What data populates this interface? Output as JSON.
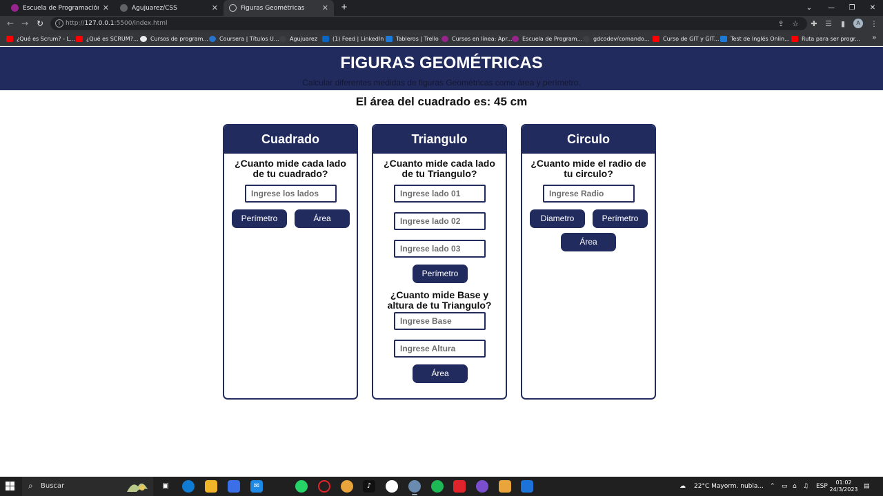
{
  "browser": {
    "tabs": [
      {
        "title": "Escuela de Programación y Desa",
        "color": "#98258e"
      },
      {
        "title": "Agujuarez/CSS",
        "color": "#5f6368"
      },
      {
        "title": "Figuras Geométricas",
        "color": "#8ab4f8"
      }
    ],
    "new_tab": "+",
    "url_prefix": "http://",
    "url_host": "127.0.0.1",
    "url_rest": ":5500/index.html",
    "profile_initial": "A"
  },
  "bookmarks": [
    {
      "label": "¿Qué es Scrum? - L...",
      "color": "#ff0000"
    },
    {
      "label": "¿Qué es SCRUM?...",
      "color": "#ff0000"
    },
    {
      "label": "Cursos de program...",
      "color": "#e8eaed"
    },
    {
      "label": "Coursera | Títulos U...",
      "color": "#2a73cc"
    },
    {
      "label": "Agujuarez",
      "color": "#3c4043"
    },
    {
      "label": "(1) Feed | LinkedIn",
      "color": "#0a66c2"
    },
    {
      "label": "Tableros | Trello",
      "color": "#1c7ad8"
    },
    {
      "label": "Cursos en línea: Apr...",
      "color": "#98258e"
    },
    {
      "label": "Escuela de Program...",
      "color": "#98258e"
    },
    {
      "label": "gdcodev/comando...",
      "color": "#3c4043"
    },
    {
      "label": "Curso de GIT y GIT...",
      "color": "#ff0000"
    },
    {
      "label": "Test de Inglés Onlin...",
      "color": "#1c7ad8"
    },
    {
      "label": "Ruta para ser progr...",
      "color": "#ff0000"
    }
  ],
  "page": {
    "title": "FIGURAS GEOMÉTRICAS",
    "subtitle": "Calcular diferentes medidas de figuras Geométricas como área y perímetro.",
    "result": "El área del cuadrado es: 45 cm",
    "accent_color": "#212b5e"
  },
  "cards": {
    "square": {
      "title": "Cuadrado",
      "question": "¿Cuanto mide cada lado de tu cuadrado?",
      "side_placeholder": "Ingrese los lados",
      "perimeter_button": "Perímetro",
      "area_button": "Área"
    },
    "triangle": {
      "title": "Triangulo",
      "question": "¿Cuanto mide cada lado de tu Triangulo?",
      "side1_placeholder": "Ingrese lado 01",
      "side2_placeholder": "Ingrese lado 02",
      "side3_placeholder": "Ingrese lado 03",
      "perimeter_button": "Perímetro",
      "question2": "¿Cuanto mide Base y altura de tu Triangulo?",
      "base_placeholder": "Ingrese Base",
      "height_placeholder": "Ingrese Altura",
      "area_button": "Área"
    },
    "circle": {
      "title": "Circulo",
      "question": "¿Cuanto mide el radio de tu circulo?",
      "radius_placeholder": "Ingrese Radio",
      "diameter_button": "Diametro",
      "perimeter_button": "Perímetro",
      "area_button": "Área"
    }
  },
  "taskbar": {
    "search_text": "Buscar",
    "weather": "22°C  Mayorm. nubla...",
    "language": "ESP",
    "time": "01:02",
    "date": "24/3/2023"
  }
}
